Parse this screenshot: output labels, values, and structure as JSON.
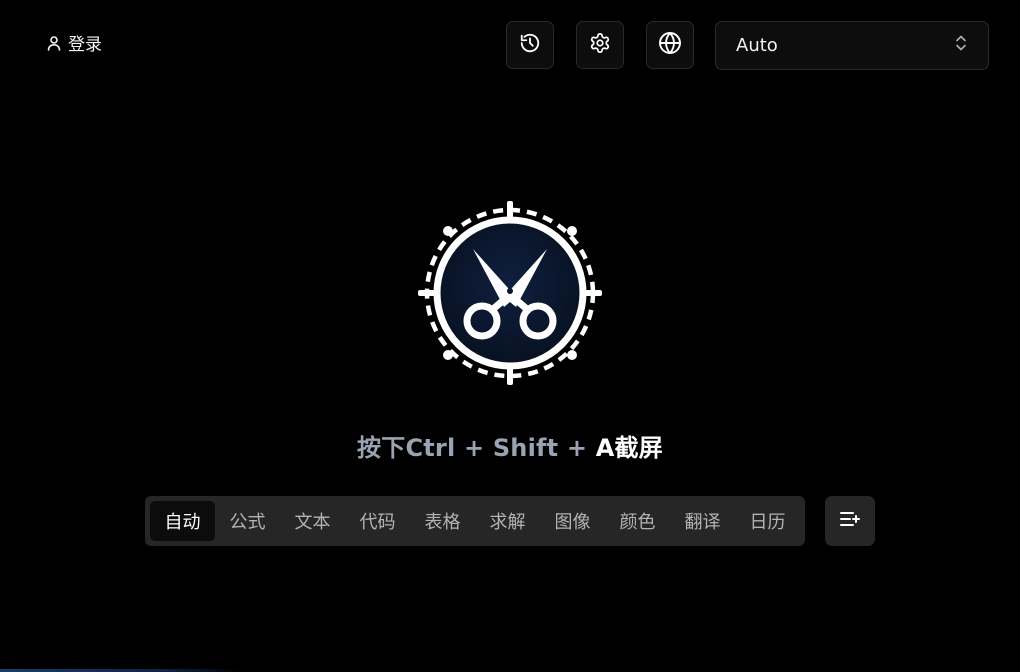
{
  "header": {
    "login_label": "登录"
  },
  "toolbar": {
    "history_icon": "history-icon",
    "settings_icon": "gear-icon",
    "language_icon": "globe-icon",
    "model_select": {
      "value": "Auto",
      "icon": "chevron-up-down-icon"
    }
  },
  "main": {
    "logo_icon": "scissors-icon",
    "hint": {
      "prefix": "按下Ctrl + Shift + ",
      "highlight": "A截屏"
    }
  },
  "modes": {
    "tabs": [
      {
        "label": "自动",
        "active": true
      },
      {
        "label": "公式",
        "active": false
      },
      {
        "label": "文本",
        "active": false
      },
      {
        "label": "代码",
        "active": false
      },
      {
        "label": "表格",
        "active": false
      },
      {
        "label": "求解",
        "active": false
      },
      {
        "label": "图像",
        "active": false
      },
      {
        "label": "颜色",
        "active": false
      },
      {
        "label": "翻译",
        "active": false
      },
      {
        "label": "日历",
        "active": false
      }
    ],
    "add_icon": "list-add-icon"
  },
  "colors": {
    "background": "#000000",
    "panel": "#262626",
    "active_tab": "#0c0c0c",
    "hint_text": "#9aa3b2",
    "logo_fill": "#0a1630"
  }
}
